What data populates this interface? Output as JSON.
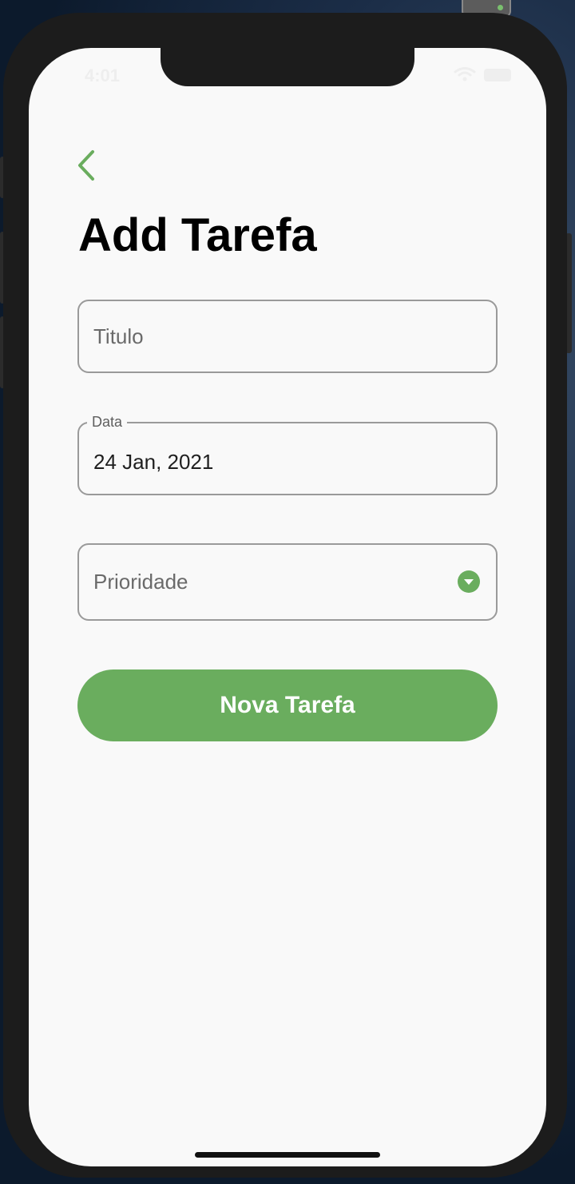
{
  "status_bar": {
    "time": "4:01"
  },
  "header": {
    "back_icon": "chevron-left-icon",
    "title": "Add Tarefa"
  },
  "form": {
    "titulo": {
      "placeholder": "Titulo",
      "value": ""
    },
    "data": {
      "label": "Data",
      "value": "24 Jan, 2021"
    },
    "prioridade": {
      "placeholder": "Prioridade",
      "icon": "dropdown-arrow-icon"
    },
    "submit_label": "Nova Tarefa"
  },
  "colors": {
    "accent": "#6aad5e",
    "background": "#f9f9f9",
    "text": "#000000",
    "border": "#9a9a9a"
  }
}
